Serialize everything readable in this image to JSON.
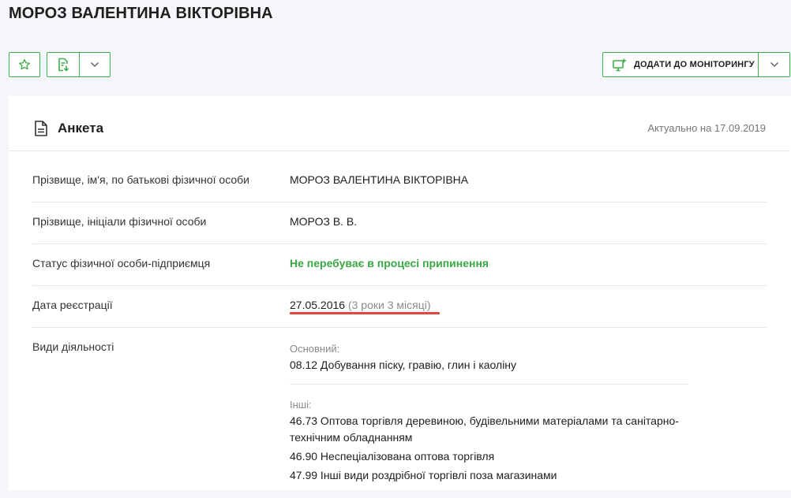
{
  "page": {
    "title": "МОРОЗ ВАЛЕНТИНА ВІКТОРІВНА"
  },
  "toolbar": {
    "favorite_icon": "star-icon",
    "export_icon": "document-download-icon",
    "dropdown_icon": "chevron-down-icon",
    "monitor_icon": "monitor-plus-icon",
    "monitor_label": "ДОДАТИ ДО МОНІТОРИНГУ",
    "accent_color": "#3fae49"
  },
  "card": {
    "title": "Анкета",
    "title_icon": "document-icon",
    "actual_date": "Актуально на 17.09.2019"
  },
  "fields": {
    "full_name": {
      "label": "Прізвище, ім'я, по батькові фізичної особи",
      "value": "МОРОЗ ВАЛЕНТИНА ВІКТОРІВНА"
    },
    "initials": {
      "label": "Прізвище, ініціали фізичної особи",
      "value": "МОРОЗ В. В."
    },
    "status": {
      "label": "Статус фізичної особи-підприємця",
      "value": "Не перебуває в процесі припинення",
      "color": "#3aa845"
    },
    "registration": {
      "label": "Дата реєстрації",
      "date": "27.05.2016",
      "duration": "(3 роки 3 місяці)",
      "highlight_color": "#e0463a"
    },
    "activities": {
      "label": "Види діяльності",
      "main_label": "Основний:",
      "main": "08.12 Добування піску, гравію, глин і каоліну",
      "other_label": "Інші:",
      "other": [
        "46.73 Оптова торгівля деревиною, будівельними матеріалами та санітарно-",
        "технічним обладнанням",
        "46.90 Неспеціалізована оптова торгівля",
        "47.99 Інші види роздрібної торгівлі поза магазинами"
      ]
    }
  }
}
